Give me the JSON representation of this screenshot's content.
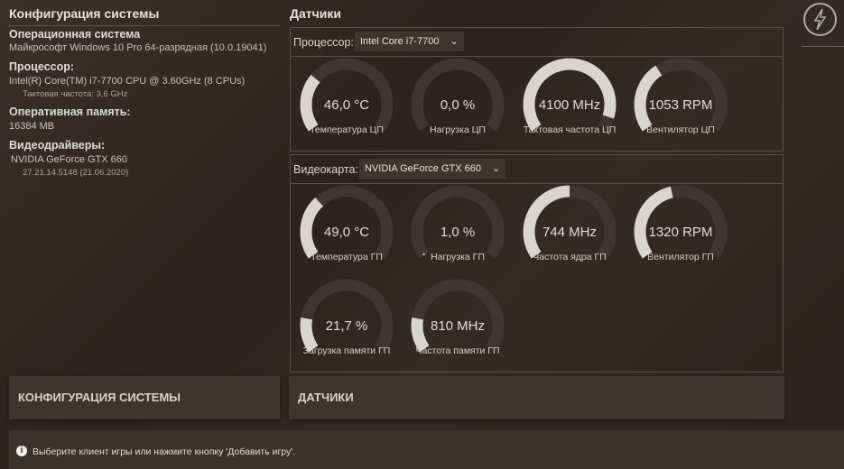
{
  "config": {
    "title": "Конфигурация системы",
    "os_label": "Операционная система",
    "os_value": "Майкрософт Windows 10 Pro 64-разрядная  (10.0.19041)",
    "cpu_label": "Процессор:",
    "cpu_value": "Intel(R) Core(TM) i7-7700 CPU @ 3.60GHz (8 CPUs)",
    "cpu_clock": "Тактовая частота: 3,6 GHz",
    "ram_label": "Оперативная память:",
    "ram_value": "16384  MB",
    "gpu_label": "Видеодрайверы:",
    "gpu_value": "NVIDIA GeForce GTX 660",
    "gpu_driver": "27.21.14.5148  (21.06.2020)"
  },
  "sensors": {
    "title": "Датчики",
    "cpu_select_label": "Процессор:",
    "cpu_select_value": "Intel Core i7-7700",
    "gpu_select_label": "Видеокарта:",
    "gpu_select_value": "NVIDIA GeForce GTX 660",
    "cpu_gauges": [
      {
        "value": "46,0 °C",
        "label": "Температура ЦП",
        "fraction": 0.3
      },
      {
        "value": "0,0 %",
        "label": "Нагрузка ЦП",
        "fraction": 0
      },
      {
        "value": "4100 MHz",
        "label": "Тактовая частота ЦП",
        "fraction": 0.93
      },
      {
        "value": "1053 RPM",
        "label": "Вентилятор ЦП",
        "fraction": 0.37
      }
    ],
    "gpu_gauges": [
      {
        "value": "49,0 °C",
        "label": "Температура ГП",
        "fraction": 0.33
      },
      {
        "value": "1,0 %",
        "label": "Нагрузка ГП",
        "fraction": 0.01
      },
      {
        "value": "744 MHz",
        "label": "Частота ядра ГП",
        "fraction": 0.5
      },
      {
        "value": "1320 RPM",
        "label": "Вентилятор ГП",
        "fraction": 0.45
      },
      {
        "value": "21,7 %",
        "label": "Загрузка памяти ГП",
        "fraction": 0.18
      },
      {
        "value": "810 MHz",
        "label": "Частота памяти ГП",
        "fraction": 0.18
      }
    ]
  },
  "tabs": {
    "config": "КОНФИГУРАЦИЯ СИСТЕМЫ",
    "sensors": "ДАТЧИКИ"
  },
  "status": {
    "message": "Выберите клиент игры или нажмите кнопку 'Добавить игру'."
  },
  "colors": {
    "gauge_fill": "#d8d4d2",
    "gauge_track": "#3c3634"
  }
}
